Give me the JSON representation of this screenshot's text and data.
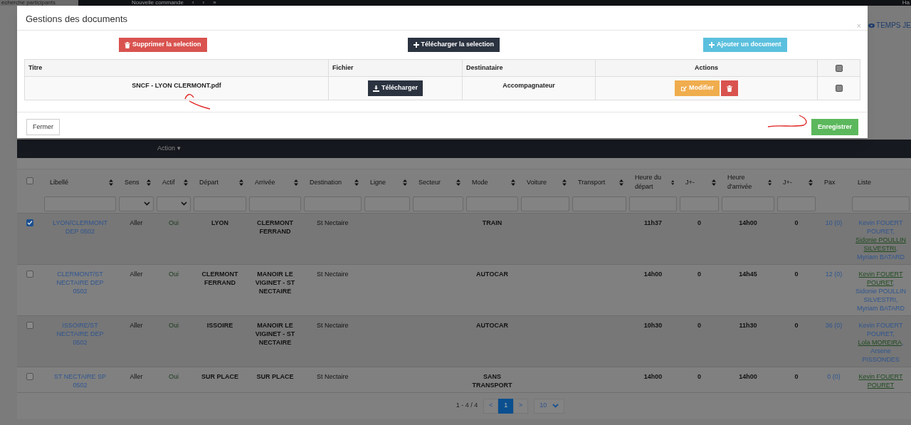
{
  "top_bar": {
    "search_text": "echerche participants",
    "new_order": "Nouvelle commande",
    "nav": [
      "‹",
      "›",
      "»"
    ],
    "user": "Ha"
  },
  "side_link": "TEMPS JE",
  "action_bar": {
    "action": "Action ▾"
  },
  "table": {
    "select_all_checked": false,
    "columns": [
      {
        "label": "Libellé",
        "sortable": true,
        "filter": {
          "kind": "text"
        }
      },
      {
        "label": "Sens",
        "sortable": true,
        "filter": {
          "kind": "select"
        }
      },
      {
        "label": "Actif",
        "sortable": true,
        "filter": {
          "kind": "select"
        }
      },
      {
        "label": "Départ",
        "sortable": true,
        "filter": {
          "kind": "text"
        }
      },
      {
        "label": "Arrivée",
        "sortable": true,
        "filter": {
          "kind": "text"
        }
      },
      {
        "label": "Destination",
        "sortable": true,
        "filter": {
          "kind": "text"
        }
      },
      {
        "label": "Ligne",
        "sortable": true,
        "filter": {
          "kind": "text"
        }
      },
      {
        "label": "Secteur",
        "sortable": true,
        "filter": {
          "kind": "text"
        }
      },
      {
        "label": "Mode",
        "sortable": true,
        "filter": {
          "kind": "text"
        }
      },
      {
        "label": "Voiture",
        "sortable": true,
        "filter": {
          "kind": "text"
        }
      },
      {
        "label": "Transport",
        "sortable": true,
        "filter": {
          "kind": "text"
        }
      },
      {
        "label": "Heure du départ",
        "sortable": true,
        "filter": {
          "kind": "text"
        }
      },
      {
        "label": "J+-",
        "sortable": true,
        "filter": {
          "kind": "text"
        }
      },
      {
        "label": "Heure d'arrivée",
        "sortable": true,
        "filter": {
          "kind": "text"
        }
      },
      {
        "label": "J+-",
        "sortable": true,
        "filter": {
          "kind": "text"
        }
      },
      {
        "label": "Pax",
        "sortable": false
      },
      {
        "label": "Liste",
        "sortable": false,
        "filter": {
          "kind": "text"
        }
      }
    ],
    "rows": [
      {
        "checked": true,
        "libelle": "LYON/CLERMONT DEP 0502",
        "sens": "Aller",
        "actif": "Oui",
        "depart": "LYON",
        "arrivee": "CLERMONT FERRAND",
        "destination": "St Nectaire",
        "mode": "TRAIN",
        "heure_depart": "11h37",
        "j1": "0",
        "heure_arrivee": "14h00",
        "j2": "0",
        "pax": "10 (0)",
        "liste": [
          {
            "name": "Kevin FOUERT POURET",
            "highlighted": false
          },
          {
            "name": "Sidonie POULLIN SILVESTRI",
            "highlighted": true
          },
          {
            "name": "Myriam BATARD",
            "highlighted": false
          }
        ]
      },
      {
        "checked": false,
        "libelle": "CLERMONT/ST NECTAIRE DEP 0502",
        "sens": "Aller",
        "actif": "Oui",
        "depart": "CLERMONT FERRAND",
        "arrivee": "MANOIR LE VIGINET - ST NECTAIRE",
        "destination": "St Nectaire",
        "mode": "AUTOCAR",
        "heure_depart": "14h00",
        "j1": "0",
        "heure_arrivee": "14h45",
        "j2": "0",
        "pax": "12 (0)",
        "liste": [
          {
            "name": "Kevin FOUERT POURET",
            "highlighted": true
          },
          {
            "name": "Sidonie POULLIN SILVESTRI",
            "highlighted": false
          },
          {
            "name": "Myriam BATARD",
            "highlighted": false
          }
        ]
      },
      {
        "checked": false,
        "libelle": "ISSOIRE/ST NECTAIRE DEP 0502",
        "sens": "Aller",
        "actif": "Oui",
        "depart": "ISSOIRE",
        "arrivee": "MANOIR LE VIGINET - ST NECTAIRE",
        "destination": "St Nectaire",
        "mode": "AUTOCAR",
        "heure_depart": "10h30",
        "j1": "0",
        "heure_arrivee": "11h30",
        "j2": "0",
        "pax": "36 (0)",
        "liste": [
          {
            "name": "Kevin FOUERT POURET",
            "highlighted": false
          },
          {
            "name": "Lola MOREIRA",
            "highlighted": true
          },
          {
            "name": "Arsene PISSONDES",
            "highlighted": false
          }
        ]
      },
      {
        "checked": false,
        "libelle": "ST NECTAIRE SP 0502",
        "sens": "Aller",
        "actif": "Oui",
        "depart": "SUR PLACE",
        "arrivee": "SUR PLACE",
        "destination": "St Nectaire",
        "mode": "SANS TRANSPORT",
        "heure_depart": "14h00",
        "j1": "0",
        "heure_arrivee": "14h00",
        "j2": "0",
        "pax": "0 (0)",
        "liste": [
          {
            "name": "Kevin FOUERT POURET",
            "highlighted": true
          }
        ]
      }
    ],
    "separator": ","
  },
  "pagination": {
    "range": "1 - 4 / 4",
    "prev": "<",
    "pages": [
      {
        "label": "1",
        "selected": true
      }
    ],
    "next": ">",
    "page_size": "10"
  },
  "modal": {
    "title": "Gestions des documents",
    "close": "×",
    "toolbar": [
      {
        "label": "Supprimer la selection",
        "kind": "danger"
      },
      {
        "label": "Télécharger la selection",
        "kind": "dark"
      },
      {
        "label": "Ajouter un document",
        "kind": "info"
      }
    ],
    "columns": [
      "Titre",
      "Fichier",
      "Destinataire",
      "Actions"
    ],
    "select_all_checked": false,
    "rows": [
      {
        "title": "SNCF - LYON CLERMONT.pdf",
        "download": "Télécharger",
        "recipient": "Accompagnateur",
        "edit": "Modifier",
        "checked": false
      }
    ],
    "close_button": "Fermer",
    "save_button": "Enregistrer"
  }
}
